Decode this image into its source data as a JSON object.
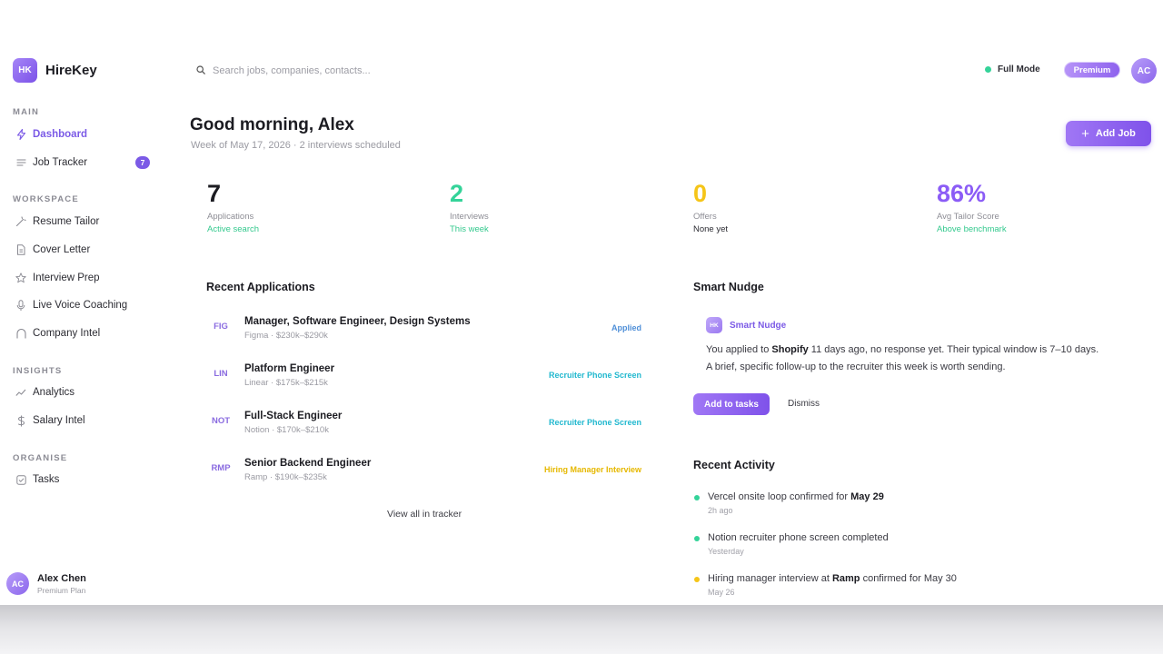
{
  "brand": {
    "logo": "HK",
    "name": "HireKey"
  },
  "sidebar": {
    "sections": {
      "main": "MAIN",
      "workspace": "WORKSPACE",
      "insights": "INSIGHTS",
      "organise": "ORGANISE"
    },
    "items": [
      {
        "label": "Dashboard",
        "icon": "bolt-icon",
        "active": true
      },
      {
        "label": "Job Tracker",
        "icon": "list-icon",
        "badge": "7"
      },
      {
        "label": "Resume Tailor",
        "icon": "wand-icon"
      },
      {
        "label": "Cover Letter",
        "icon": "document-icon"
      },
      {
        "label": "Interview Prep",
        "icon": "star-icon"
      },
      {
        "label": "Live Voice Coaching",
        "icon": "microphone-icon"
      },
      {
        "label": "Company Intel",
        "icon": "building-icon"
      },
      {
        "label": "Analytics",
        "icon": "trend-icon"
      },
      {
        "label": "Salary Intel",
        "icon": "dollar-icon"
      },
      {
        "label": "Tasks",
        "icon": "checkbox-icon"
      }
    ],
    "user": {
      "initials": "AC",
      "name": "Alex Chen",
      "plan": "Premium Plan"
    }
  },
  "header": {
    "search_placeholder": "Search jobs, companies, contacts...",
    "mode_label": "Full Mode",
    "premium_label": "Premium",
    "avatar_initials": "AC"
  },
  "greeting": {
    "title": "Good morning, Alex",
    "subtitle": "Week of May 17, 2026 · 2 interviews scheduled",
    "add_job_label": "Add Job"
  },
  "stats": [
    {
      "value": "7",
      "label": "Applications",
      "note": "Active search",
      "color": "#1c1c22",
      "note_color": "#34c98e"
    },
    {
      "value": "2",
      "label": "Interviews",
      "note": "This week",
      "color": "#34d399",
      "note_color": "#34c98e"
    },
    {
      "value": "0",
      "label": "Offers",
      "note": "None yet",
      "color": "#f5c518",
      "note_color": "#2c2c33"
    },
    {
      "value": "86%",
      "label": "Avg Tailor Score",
      "note": "Above benchmark",
      "color": "#8b5cf6",
      "note_color": "#34c98e"
    }
  ],
  "recent_applications": {
    "title": "Recent Applications",
    "rows": [
      {
        "code": "FIG",
        "title": "Manager, Software Engineer, Design Systems",
        "meta": "Figma · $230k–$290k",
        "status": "Applied",
        "status_color": "#4f8fd8"
      },
      {
        "code": "LIN",
        "title": "Platform Engineer",
        "meta": "Linear · $175k–$215k",
        "status": "Recruiter Phone Screen",
        "status_color": "#22b8cf"
      },
      {
        "code": "NOT",
        "title": "Full-Stack Engineer",
        "meta": "Notion · $170k–$210k",
        "status": "Recruiter Phone Screen",
        "status_color": "#22b8cf"
      },
      {
        "code": "RMP",
        "title": "Senior Backend Engineer",
        "meta": "Ramp · $190k–$235k",
        "status": "Hiring Manager Interview",
        "status_color": "#e6b800"
      }
    ],
    "view_all_label": "View all in tracker"
  },
  "smart_nudge": {
    "title": "Smart Nudge",
    "badge_logo": "HK",
    "badge_label": "Smart Nudge",
    "body_prefix": "You applied to ",
    "body_company": "Shopify",
    "body_suffix": " 11 days ago, no response yet. Their typical window is 7–10 days. A brief, specific follow-up to the recruiter this week is worth sending.",
    "primary_action": "Add to tasks",
    "secondary_action": "Dismiss"
  },
  "recent_activity": {
    "title": "Recent Activity",
    "items": [
      {
        "text_prefix": "Vercel onsite loop confirmed for ",
        "text_bold": "May 29",
        "text_suffix": "",
        "time": "2h ago",
        "dot_color": "#34d399"
      },
      {
        "text_prefix": "Notion recruiter phone screen completed",
        "text_bold": "",
        "text_suffix": "",
        "time": "Yesterday",
        "dot_color": "#34d399"
      },
      {
        "text_prefix": "Hiring manager interview at ",
        "text_bold": "Ramp",
        "text_suffix": " confirmed for May 30",
        "time": "May 26",
        "dot_color": "#f5c518"
      }
    ]
  }
}
